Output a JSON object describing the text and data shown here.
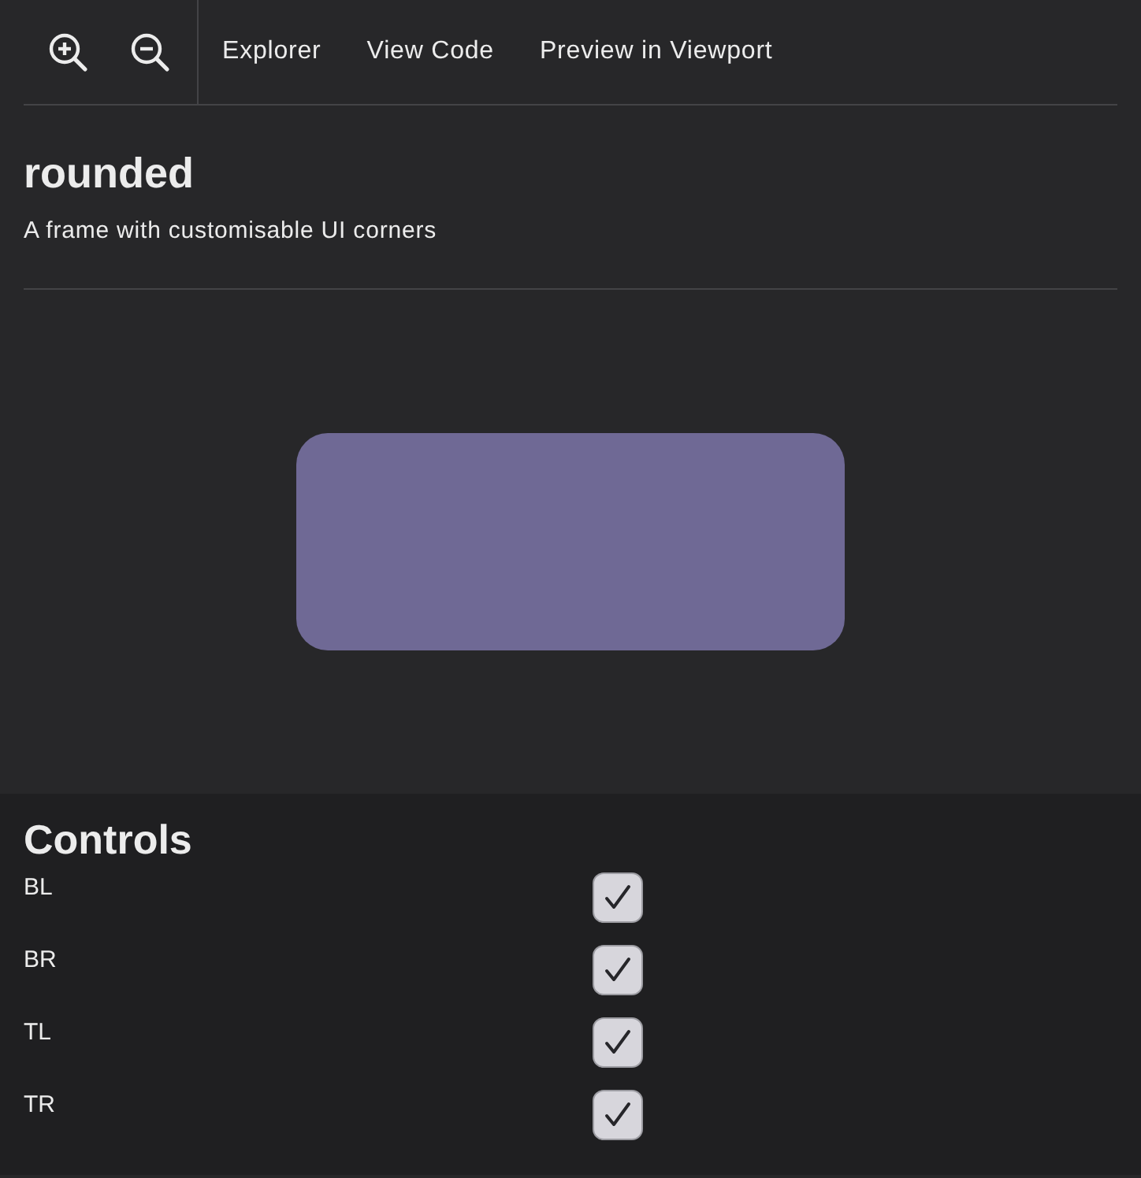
{
  "toolbar": {
    "links": [
      "Explorer",
      "View Code",
      "Preview in Viewport"
    ]
  },
  "story": {
    "title": "rounded",
    "description": "A frame with customisable UI corners"
  },
  "controls": {
    "title": "Controls",
    "items": [
      {
        "label": "BL",
        "checked": true
      },
      {
        "label": "BR",
        "checked": true
      },
      {
        "label": "TL",
        "checked": true
      },
      {
        "label": "TR",
        "checked": true
      }
    ]
  }
}
